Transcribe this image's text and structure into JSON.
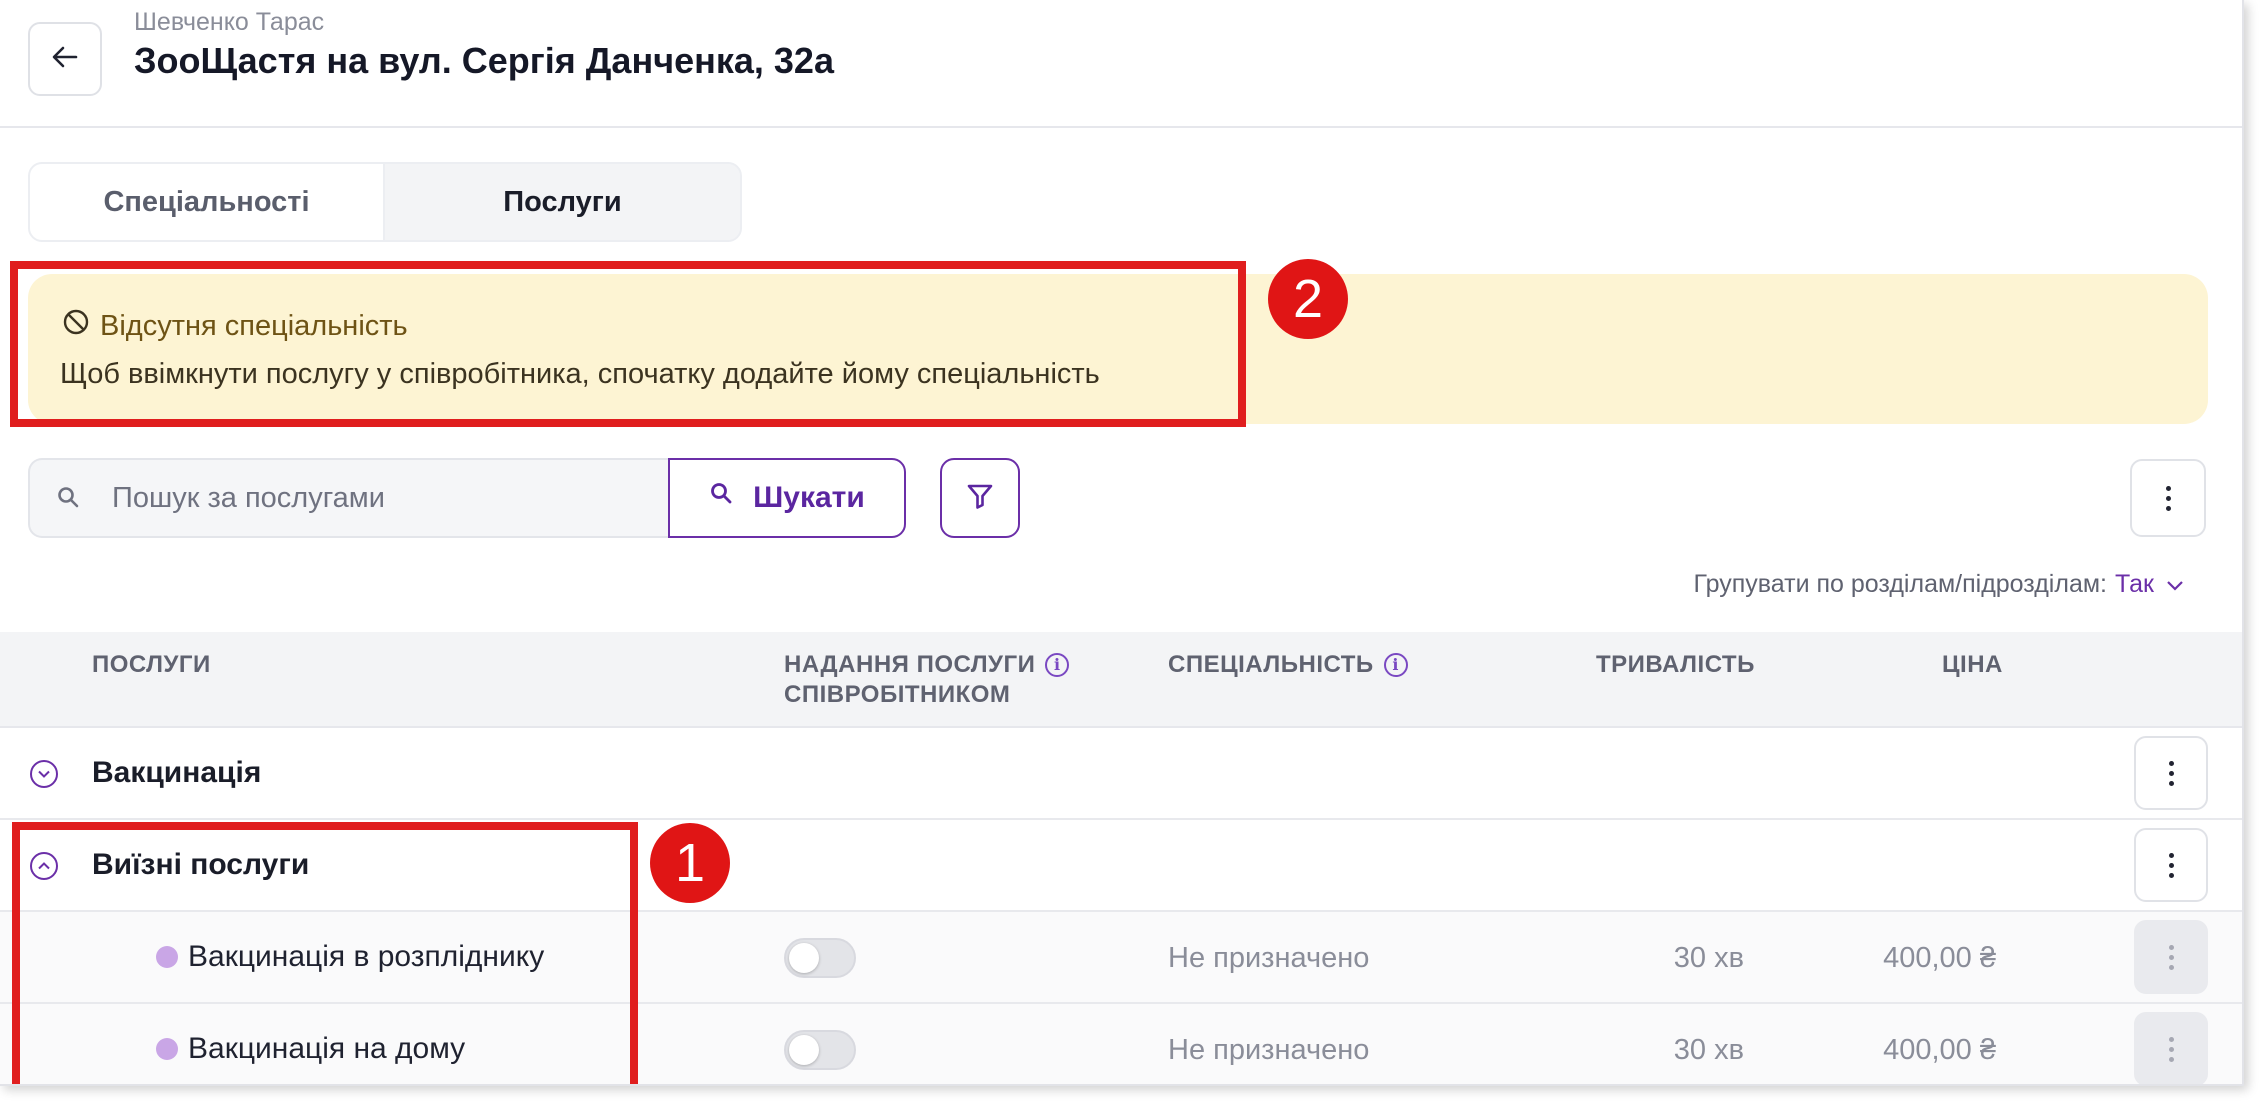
{
  "header": {
    "subtitle": "Шевченко Тарас",
    "title": "ЗооЩастя на вул. Сергія Данченка, 32а"
  },
  "tabs": [
    {
      "label": "Спеціальності",
      "active": false
    },
    {
      "label": "Послуги",
      "active": true
    }
  ],
  "banner": {
    "heading": "Відсутня спеціальність",
    "text": "Щоб ввімкнути послугу у співробітника, спочатку додайте йому спеціальність",
    "background": "#fdf4d3"
  },
  "annotations": [
    {
      "number": "1"
    },
    {
      "number": "2"
    }
  ],
  "search": {
    "placeholder": "Пошук за послугами",
    "button_label": "Шукати"
  },
  "grouping": {
    "label": "Групувати по розділам/підрозділам:",
    "value": "Так"
  },
  "table": {
    "columns": {
      "services": "ПОСЛУГИ",
      "provision_line1": "НАДАННЯ ПОСЛУГИ",
      "provision_line2": "СПІВРОБІТНИКОМ",
      "specialty": "СПЕЦІАЛЬНІСТЬ",
      "duration": "ТРИВАЛІСТЬ",
      "price": "ЦІНА"
    },
    "categories": [
      {
        "name": "Вакцинація",
        "expanded": false
      },
      {
        "name": "Виїзні послуги",
        "expanded": true
      }
    ],
    "services": [
      {
        "name": "Вакцинація в розпліднику",
        "enabled": false,
        "specialty": "Не призначено",
        "duration": "30 хв",
        "price": "400,00 ₴"
      },
      {
        "name": "Вакцинація на дому",
        "enabled": false,
        "specialty": "Не призначено",
        "duration": "30 хв",
        "price": "400,00 ₴"
      }
    ]
  },
  "colors": {
    "accent": "#6b2fa8",
    "annotation": "#e01e1e",
    "service_dot": "#c9a6e6"
  }
}
